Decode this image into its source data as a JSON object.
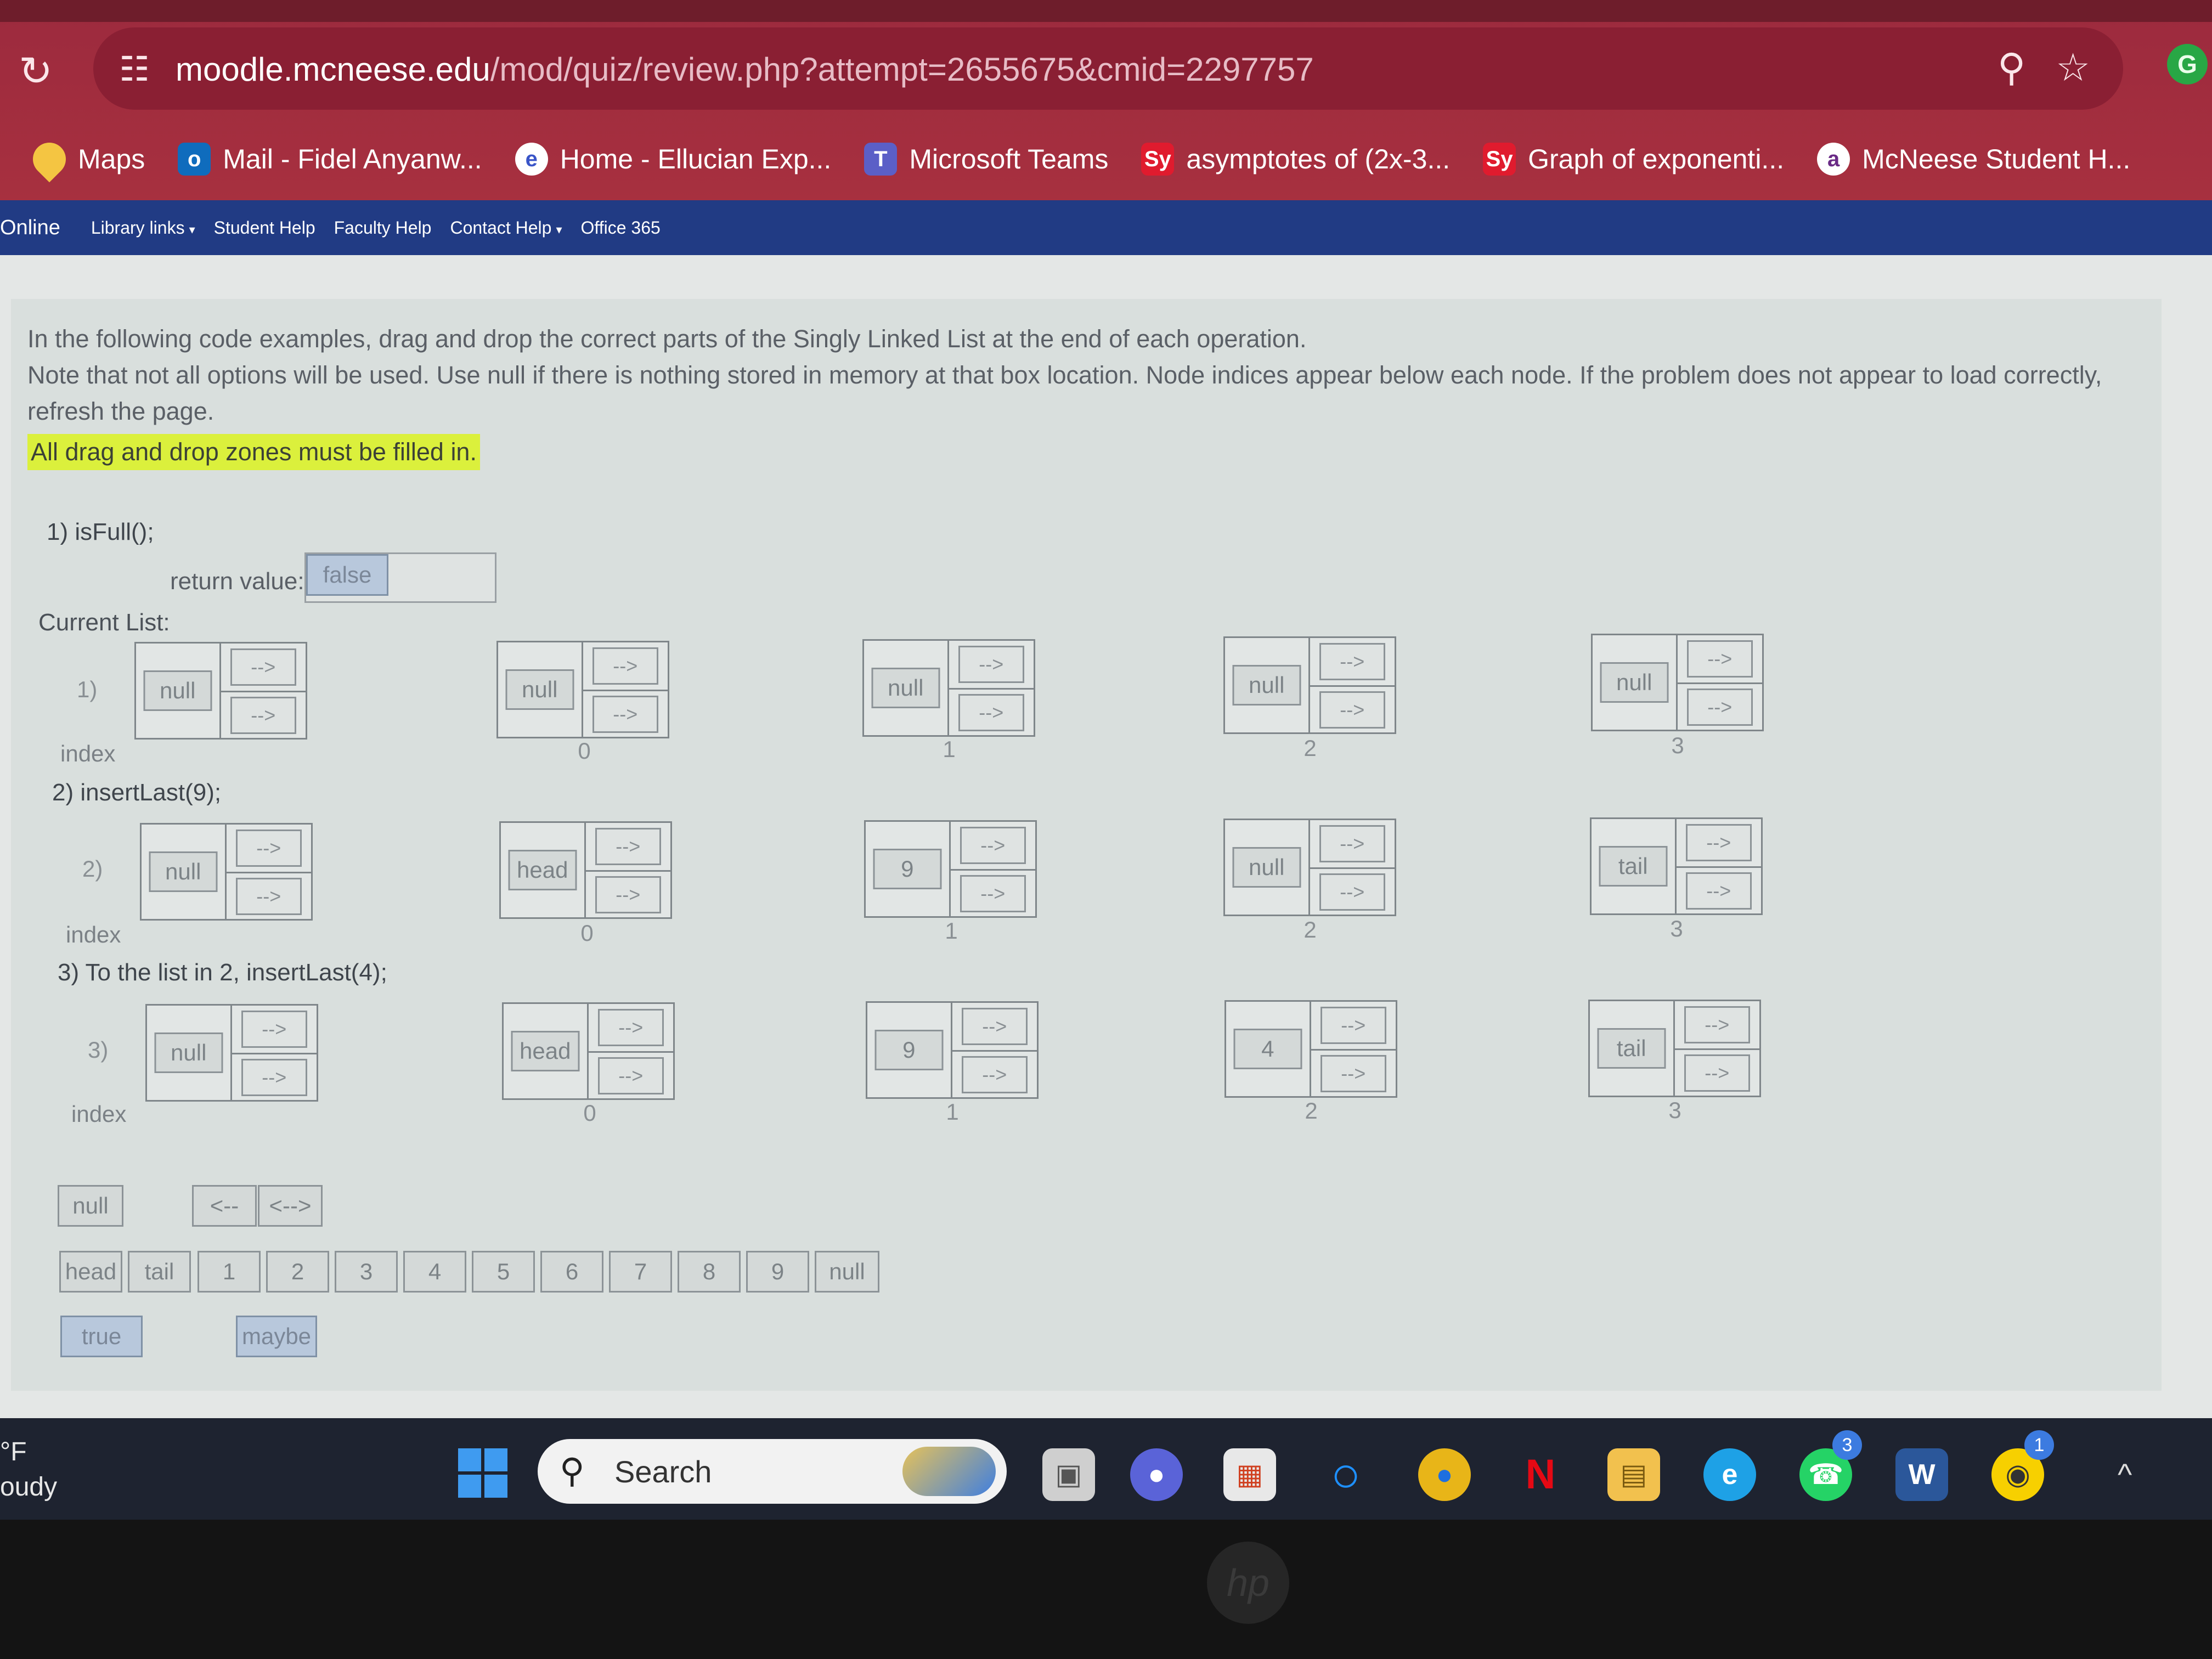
{
  "browser": {
    "url_host": "moodle.mcneese.edu",
    "url_path": "/mod/quiz/review.php?attempt=2655675&cmid=2297757",
    "bookmarks": [
      {
        "label": "Maps",
        "icon": "maps-pin-icon"
      },
      {
        "label": "Mail - Fidel Anyanw...",
        "icon": "outlook-mail-icon"
      },
      {
        "label": "Home - Ellucian Exp...",
        "icon": "ellucian-icon"
      },
      {
        "label": "Microsoft Teams",
        "icon": "teams-icon"
      },
      {
        "label": "asymptotes of (2x-3...",
        "icon": "symbolab-icon"
      },
      {
        "label": "Graph of exponenti...",
        "icon": "symbolab-icon"
      },
      {
        "label": "McNeese Student H...",
        "icon": "mcneese-icon"
      }
    ],
    "profile_initial": "G"
  },
  "navbar": {
    "first": "Online",
    "items": [
      {
        "label": "Library links",
        "dropdown": true
      },
      {
        "label": "Student Help",
        "dropdown": false
      },
      {
        "label": "Faculty Help",
        "dropdown": false
      },
      {
        "label": "Contact Help",
        "dropdown": true
      },
      {
        "label": "Office 365",
        "dropdown": false
      }
    ]
  },
  "quiz": {
    "intro_line1": "In the following code examples, drag and drop the correct parts of the Singly Linked List at the end of each operation.",
    "intro_line2": "Note that not all options will be used. Use null if there is nothing stored in memory at that box location. Node indices appear below each node. If the problem does not appear to load correctly, refresh the page.",
    "intro_highlight": "All drag and drop zones must be filled in.",
    "q1_title": "1) isFull();",
    "return_label": "return value:",
    "return_value": "false",
    "current_list_label": "Current List:",
    "index_label": "index",
    "rows": [
      {
        "label": "1)",
        "nodes": [
          {
            "data": "null",
            "p1": "-->",
            "p2": "-->",
            "index": ""
          },
          {
            "data": "null",
            "p1": "-->",
            "p2": "-->",
            "index": "0"
          },
          {
            "data": "null",
            "p1": "-->",
            "p2": "-->",
            "index": "1"
          },
          {
            "data": "null",
            "p1": "-->",
            "p2": "-->",
            "index": "2"
          },
          {
            "data": "null",
            "p1": "-->",
            "p2": "-->",
            "index": "3"
          }
        ]
      },
      {
        "title": "2) insertLast(9);",
        "label": "2)",
        "nodes": [
          {
            "data": "null",
            "p1": "-->",
            "p2": "-->",
            "index": ""
          },
          {
            "data": "head",
            "p1": "-->",
            "p2": "-->",
            "index": "0"
          },
          {
            "data": "9",
            "p1": "-->",
            "p2": "-->",
            "index": "1"
          },
          {
            "data": "null",
            "p1": "-->",
            "p2": "-->",
            "index": "2"
          },
          {
            "data": "tail",
            "p1": "-->",
            "p2": "-->",
            "index": "3"
          }
        ]
      },
      {
        "title": "3) To the list in 2, insertLast(4);",
        "label": "3)",
        "nodes": [
          {
            "data": "null",
            "p1": "-->",
            "p2": "-->",
            "index": ""
          },
          {
            "data": "head",
            "p1": "-->",
            "p2": "-->",
            "index": "0"
          },
          {
            "data": "9",
            "p1": "-->",
            "p2": "-->",
            "index": "1"
          },
          {
            "data": "4",
            "p1": "-->",
            "p2": "-->",
            "index": "2"
          },
          {
            "data": "tail",
            "p1": "-->",
            "p2": "-->",
            "index": "3"
          }
        ]
      }
    ],
    "pool": {
      "null": "null",
      "arrows": [
        "<--",
        "<-->"
      ],
      "values": [
        "head",
        "tail",
        "1",
        "2",
        "3",
        "4",
        "5",
        "6",
        "7",
        "8",
        "9",
        "null"
      ],
      "bools": [
        "true",
        "maybe"
      ]
    }
  },
  "taskbar": {
    "weather_unit": "°F",
    "weather_text": "oudy",
    "search_label": "Search",
    "whatsapp_badge": "3",
    "other_badge": "1"
  },
  "colors": {
    "chrome": "#a7303f",
    "navbar": "#213b84",
    "highlight": "#dbf03c",
    "taskbar": "#1e2330"
  }
}
